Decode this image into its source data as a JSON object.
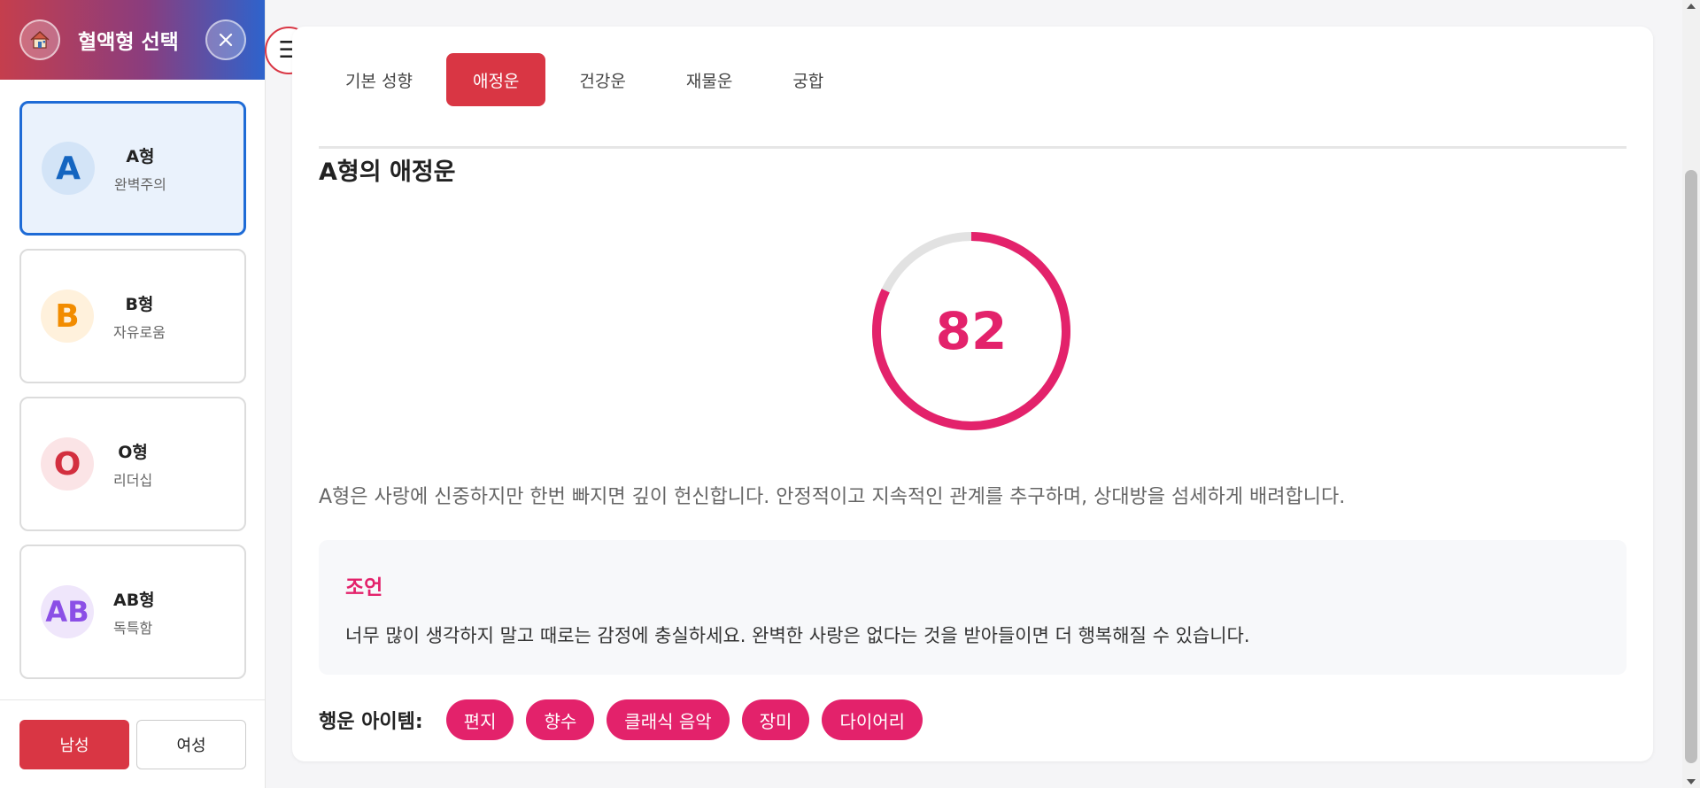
{
  "sidebar": {
    "title": "혈액형 선택",
    "types": [
      {
        "letter": "A",
        "name": "A형",
        "desc": "완벽주의",
        "color": "#1565c0",
        "bg": "#d3e4f7",
        "active": true
      },
      {
        "letter": "B",
        "name": "B형",
        "desc": "자유로움",
        "color": "#f28c00",
        "bg": "#fff1dc",
        "active": false
      },
      {
        "letter": "O",
        "name": "O형",
        "desc": "리더십",
        "color": "#d32f3f",
        "bg": "#fbe4e6",
        "active": false
      },
      {
        "letter": "AB",
        "name": "AB형",
        "desc": "독특함",
        "color": "#8b4fe6",
        "bg": "#efe6fb",
        "active": false
      }
    ],
    "gender": {
      "male": "남성",
      "female": "여성",
      "selected": "male"
    }
  },
  "tabs": [
    {
      "label": "기본 성향",
      "active": false
    },
    {
      "label": "애정운",
      "active": true
    },
    {
      "label": "건강운",
      "active": false
    },
    {
      "label": "재물운",
      "active": false
    },
    {
      "label": "궁합",
      "active": false
    }
  ],
  "main": {
    "title": "A형의 애정운",
    "score": 82,
    "score_max": 100,
    "description": "A형은 사랑에 신중하지만 한번 빠지면 깊이 헌신합니다. 안정적이고 지속적인 관계를 추구하며, 상대방을 섬세하게 배려합니다.",
    "advice": {
      "title": "조언",
      "text": "너무 많이 생각하지 말고 때로는 감정에 충실하세요. 완벽한 사랑은 없다는 것을 받아들이면 더 행복해질 수 있습니다."
    },
    "lucky": {
      "label": "행운 아이템:",
      "items": [
        "편지",
        "향수",
        "클래식 음악",
        "장미",
        "다이어리"
      ]
    }
  },
  "colors": {
    "accent": "#d93644",
    "score": "#e3226b",
    "track": "#e2e2e2",
    "selected_border": "#1e6bd6"
  },
  "icons": {
    "home": "house-icon",
    "close": "close-icon",
    "menu": "hamburger-menu-icon"
  }
}
